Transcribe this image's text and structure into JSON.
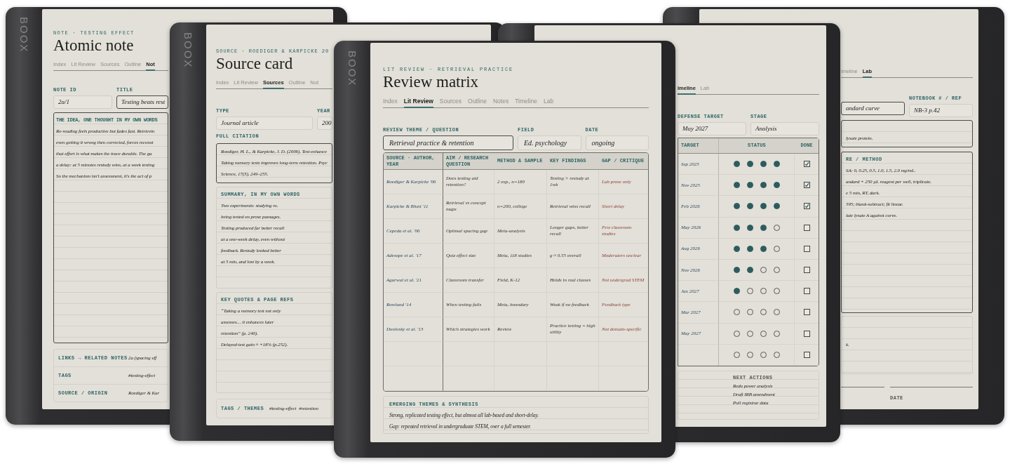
{
  "devices": [
    {
      "kind": "note",
      "brand": "BOOX",
      "eyebrow": "NOTE · TESTING EFFECT",
      "title": "Atomic note",
      "tabs": [
        {
          "label": "Index",
          "selected": false
        },
        {
          "label": "Lit Review",
          "selected": false
        },
        {
          "label": "Sources",
          "selected": false
        },
        {
          "label": "Outline",
          "selected": false
        },
        {
          "label": "Not",
          "selected": true
        }
      ],
      "fields": [
        {
          "label": "NOTE ID",
          "value": "2a/1",
          "focused": false
        },
        {
          "label": "TITLE",
          "value": "Testing beats rest",
          "focused": true
        }
      ],
      "idea": {
        "heading": "THE IDEA, ONE THOUGHT IN MY OWN WORDS",
        "focused": true,
        "lines": [
          "Re-reading feels productive but fades fast. Retrievin",
          "even getting it wrong then corrected, forces reconst",
          "that effort is what makes the trace durable. The ga",
          "a delay: at 5 minutes restudy wins, at a week testing",
          "So the mechanism isn't assessment, it's the act of p"
        ]
      },
      "footer": [
        {
          "label": "LINKS → RELATED NOTES",
          "value": "2a (spacing eff"
        },
        {
          "label": "TAGS",
          "value": "#testing-effect"
        },
        {
          "label": "SOURCE / ORIGIN",
          "value": "Roediger & Kar"
        }
      ]
    },
    {
      "kind": "source",
      "brand": "BOOX",
      "eyebrow": "SOURCE · ROEDIGER & KARPICKE 20",
      "title": "Source card",
      "tabs": [
        {
          "label": "Index",
          "selected": false
        },
        {
          "label": "Lit Review",
          "selected": false
        },
        {
          "label": "Sources",
          "selected": true
        },
        {
          "label": "Outline",
          "selected": false
        },
        {
          "label": "Not",
          "selected": false
        }
      ],
      "fields": [
        {
          "label": "TYPE",
          "value": "Journal article",
          "focused": false
        },
        {
          "label": "YEAR",
          "value": "200",
          "focused": false
        }
      ],
      "citation": {
        "label": "FULL CITATION",
        "focused": true,
        "lines": [
          "Roediger, H. L., & Karpicke, J. D. (2006). Test-enhance",
          "Taking memory tests improves long-term retention. Psyc",
          "Science, 17(3), 249–255."
        ]
      },
      "sections": [
        {
          "heading": "SUMMARY, IN MY OWN WORDS",
          "focused": false,
          "lines": [
            "Two experiments: studying vs.",
            "being tested on prose passages.",
            "Testing produced far better recall",
            "at a one-week delay, even without",
            "feedback. Restudy looked better",
            "at 5 min, and lost by a week."
          ]
        },
        {
          "heading": "KEY QUOTES & PAGE REFS",
          "focused": false,
          "lines": [
            "“Taking a memory test not only",
            "assesses… it enhances later",
            "retention” (p. 249).",
            "Delayed-test gain ≈ +18% (p.252)."
          ]
        }
      ],
      "tags": {
        "label": "TAGS / THEMES",
        "values": [
          "#testing-effect",
          "#retention"
        ]
      }
    },
    {
      "kind": "review",
      "brand": "BOOX",
      "eyebrow": "LIT REVIEW · RETRIEVAL PRACTICE",
      "title": "Review matrix",
      "tabs": [
        {
          "label": "Index",
          "selected": false
        },
        {
          "label": "Lit Review",
          "selected": true
        },
        {
          "label": "Sources",
          "selected": false
        },
        {
          "label": "Outline",
          "selected": false
        },
        {
          "label": "Notes",
          "selected": false
        },
        {
          "label": "Timeline",
          "selected": false
        },
        {
          "label": "Lab",
          "selected": false
        }
      ],
      "fields": [
        {
          "label": "REVIEW THEME / QUESTION",
          "value": "Retrieval practice & retention",
          "focused": true
        },
        {
          "label": "FIELD",
          "value": "Ed. psychology",
          "focused": false
        },
        {
          "label": "DATE",
          "value": "ongoing",
          "focused": false
        }
      ],
      "table": {
        "columns": [
          "SOURCE · AUTHOR, YEAR",
          "AIM / RESEARCH QUESTION",
          "METHOD & SAMPLE",
          "KEY FINDINGS",
          "GAP / CRITIQUE"
        ],
        "rows": [
          [
            "Roediger & Karpicke '06",
            "Does testing aid retention?",
            "2 exp., n=180",
            "Testing > restudy at 1wk",
            "Lab prose only"
          ],
          [
            "Karpicke & Blunt '11",
            "Retrieval vs concept maps",
            "n=200, college",
            "Retrieval wins recall",
            "Short delay"
          ],
          [
            "Cepeda et al. '06",
            "Optimal spacing gap",
            "Meta-analysis",
            "Longer gaps, better recall",
            "Few classroom studies"
          ],
          [
            "Adesope et al. '17",
            "Quiz effect size",
            "Meta, 118 studies",
            "g ≈ 0.55 overall",
            "Moderators unclear"
          ],
          [
            "Agarwal et al. '21",
            "Classroom transfer",
            "Field, K-12",
            "Holds in real classes",
            "Not undergrad STEM"
          ],
          [
            "Rowland '14",
            "When testing fails",
            "Meta, boundary",
            "Weak if no feedback",
            "Feedback type"
          ],
          [
            "Dunlosky et al. '13",
            "Which strategies work",
            "Review",
            "Practice testing = high utility",
            "Not domain-specific"
          ]
        ]
      },
      "synthesis": {
        "heading": "EMERGING THEMES & SYNTHESIS",
        "focused": false,
        "lines": [
          "Strong, replicated testing effect, but almost all lab-based and short-delay.",
          "Gap: repeated retrieval in undergraduate STEM, over a full semester."
        ]
      }
    },
    {
      "kind": "timeline",
      "tabs": [
        {
          "label": "imeline",
          "selected": true
        },
        {
          "label": "Lab",
          "selected": false
        }
      ],
      "fields": [
        {
          "label": "DEFENSE TARGET",
          "value": "May 2027",
          "focused": false
        },
        {
          "label": "STAGE",
          "value": "Analysis",
          "focused": false
        }
      ],
      "table": {
        "columns": [
          "TARGET",
          "STATUS",
          "DONE"
        ],
        "rows": [
          {
            "target": "Sep 2025",
            "stars": 4,
            "done": true
          },
          {
            "target": "Nov 2025",
            "stars": 4,
            "done": true
          },
          {
            "target": "Feb 2026",
            "stars": 4,
            "done": true
          },
          {
            "target": "May 2026",
            "stars": 3,
            "done": false
          },
          {
            "target": "Aug 2026",
            "stars": 3,
            "done": false
          },
          {
            "target": "Nov 2026",
            "stars": 2,
            "done": false
          },
          {
            "target": "Jan 2027",
            "stars": 1,
            "done": false
          },
          {
            "target": "Mar 2027",
            "stars": 0,
            "done": false
          },
          {
            "target": "May 2027",
            "stars": 0,
            "done": false
          },
          {
            "stars": 0,
            "done": false
          }
        ]
      },
      "next_actions": {
        "heading": "NEXT ACTIONS",
        "items": [
          "Redo power analysis",
          "Draft IRB amendment",
          "Pull registrar data"
        ]
      }
    },
    {
      "kind": "lab",
      "tabs": [
        {
          "label": "imeline",
          "selected": false
        },
        {
          "label": "Lab",
          "selected": true
        }
      ],
      "fields": [
        {
          "value": "andard curve",
          "focused": true
        },
        {
          "label": "NOTEBOOK # / REF",
          "value": "NB-3 p.42",
          "focused": false
        }
      ],
      "boxes": [
        {
          "focused": true,
          "lines": [
            "lysate protein."
          ]
        },
        {
          "heading": "RE / METHOD",
          "focused": true,
          "lines": [
            "SA: 0, 0.25, 0.5, 1.0, 1.5, 2.0 mg/mL.",
            "andard + 250 µL reagent per well, triplicate.",
            "e 5 min, RT, dark.",
            "595; blank-subtract; fit linear.",
            "late lysate A against curve."
          ]
        },
        {
          "focused": false,
          "lines": [
            "k."
          ]
        }
      ],
      "footer_label": "DATE"
    }
  ]
}
